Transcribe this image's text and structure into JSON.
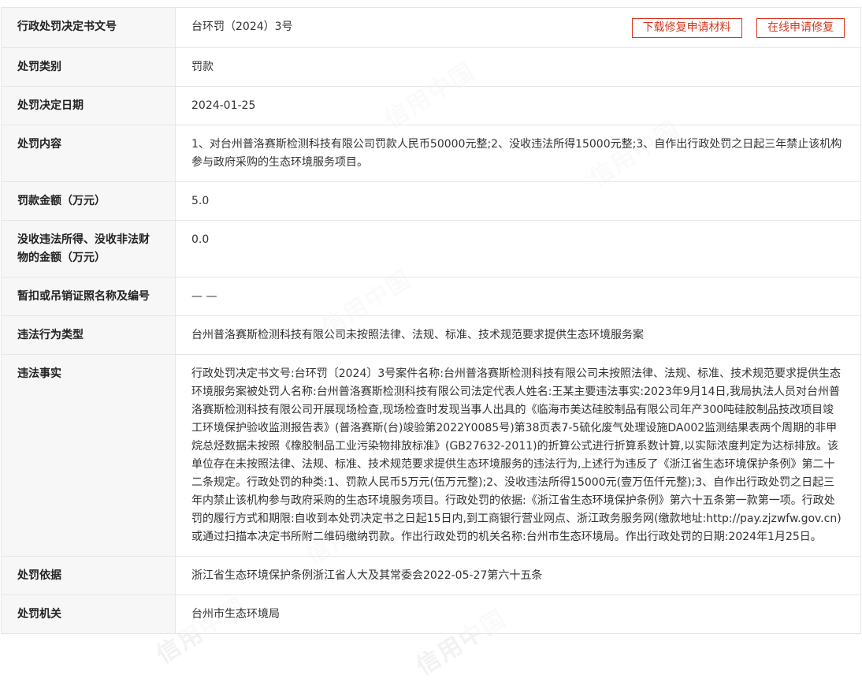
{
  "watermark": "信用中国",
  "decision_number": {
    "label": "行政处罚决定书文号",
    "value": "台环罚（2024）3号",
    "buttons": [
      "下载修复申请材料",
      "在线申请修复"
    ]
  },
  "rows": [
    {
      "label": "处罚类别",
      "value": "罚款"
    },
    {
      "label": "处罚决定日期",
      "value": "2024-01-25"
    },
    {
      "label": "处罚内容",
      "value": "1、对台州普洛赛斯检测科技有限公司罚款人民币50000元整;2、没收违法所得15000元整;3、自作出行政处罚之日起三年禁止该机构参与政府采购的生态环境服务项目。"
    },
    {
      "label": "罚款金额（万元）",
      "value": "5.0"
    },
    {
      "label": "没收违法所得、没收非法财物的金额（万元）",
      "value": "0.0"
    },
    {
      "label": "暂扣或吊销证照名称及编号",
      "value": "— —"
    },
    {
      "label": "违法行为类型",
      "value": "台州普洛赛斯检测科技有限公司未按照法律、法规、标准、技术规范要求提供生态环境服务案"
    },
    {
      "label": "违法事实",
      "value": "行政处罚决定书文号:台环罚〔2024〕3号案件名称:台州普洛赛斯检测科技有限公司未按照法律、法规、标准、技术规范要求提供生态环境服务案被处罚人名称:台州普洛赛斯检测科技有限公司法定代表人姓名:王某主要违法事实:2023年9月14日,我局执法人员对台州普洛赛斯检测科技有限公司开展现场检查,现场检查时发现当事人出具的《临海市美达硅胶制品有限公司年产300吨硅胶制品技改项目竣工环境保护验收监测报告表》(普洛赛斯(台)竣验第2022Y0085号)第38页表7-5硫化废气处理设施DA002监测结果表两个周期的非甲烷总烃数据未按照《橡胶制品工业污染物排放标准》(GB27632-2011)的折算公式进行折算系数计算,以实际浓度判定为达标排放。该单位存在未按照法律、法规、标准、技术规范要求提供生态环境服务的违法行为,上述行为违反了《浙江省生态环境保护条例》第二十二条规定。行政处罚的种类:1、罚款人民币5万元(伍万元整);2、没收违法所得15000元(壹万伍仟元整);3、自作出行政处罚之日起三年内禁止该机构参与政府采购的生态环境服务项目。行政处罚的依据:《浙江省生态环境保护条例》第六十五条第一款第一项。行政处罚的履行方式和期限:自收到本处罚决定书之日起15日内,到工商银行营业网点、浙江政务服务网(缴款地址:http://pay.zjzwfw.gov.cn)或通过扫描本决定书所附二维码缴纳罚款。作出行政处罚的机关名称:台州市生态环境局。作出行政处罚的日期:2024年1月25日。"
    },
    {
      "label": "处罚依据",
      "value": "浙江省生态环境保护条例浙江省人大及其常委会2022-05-27第六十五条"
    },
    {
      "label": "处罚机关",
      "value": "台州市生态环境局"
    }
  ]
}
